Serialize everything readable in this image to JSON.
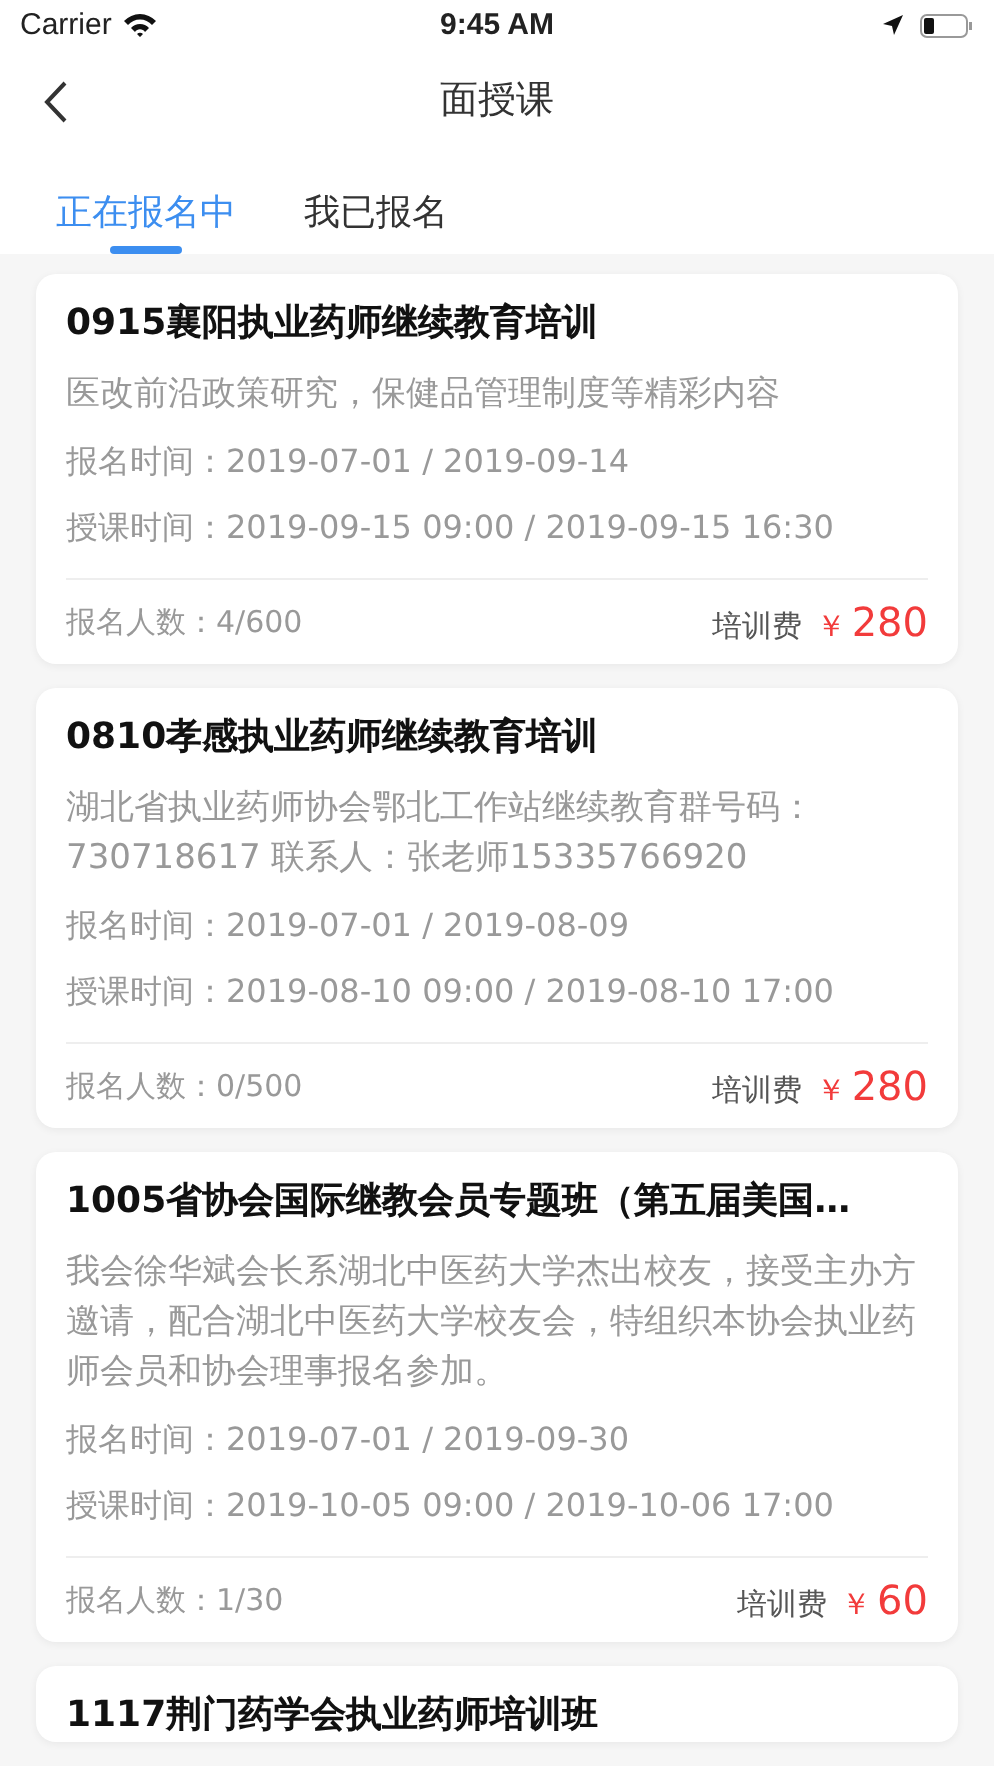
{
  "status_bar": {
    "carrier": "Carrier",
    "time": "9:45 AM"
  },
  "nav": {
    "title": "面授课"
  },
  "tabs": [
    {
      "label": "正在报名中",
      "selected": true
    },
    {
      "label": "我已报名",
      "selected": false
    }
  ],
  "courses": [
    {
      "title": "0915襄阳执业药师继续教育培训",
      "description": "医改前沿政策研究，保健品管理制度等精彩内容",
      "signup_time": "报名时间：2019-07-01 / 2019-09-14",
      "class_time": "授课时间：2019-09-15 09:00 / 2019-09-15 16:30",
      "enrollment": "报名人数：4/600",
      "fee_label": "培训费",
      "currency": "￥",
      "price": "280"
    },
    {
      "title": "0810孝感执业药师继续教育培训",
      "description": "湖北省执业药师协会鄂北工作站继续教育群号码：730718617  联系人：张老师15335766920",
      "signup_time": "报名时间：2019-07-01 / 2019-08-09",
      "class_time": "授课时间：2019-08-10 09:00 / 2019-08-10 17:00",
      "enrollment": "报名人数：0/500",
      "fee_label": "培训费",
      "currency": "￥",
      "price": "280"
    },
    {
      "title": "1005省协会国际继教会员专题班（第五届美国…",
      "description": "我会徐华斌会长系湖北中医药大学杰出校友，接受主办方邀请，配合湖北中医药大学校友会，特组织本协会执业药师会员和协会理事报名参加。",
      "signup_time": "报名时间：2019-07-01 / 2019-09-30",
      "class_time": "授课时间：2019-10-05 09:00 / 2019-10-06 17:00",
      "enrollment": "报名人数：1/30",
      "fee_label": "培训费",
      "currency": "￥",
      "price": "60"
    },
    {
      "title": "1117荆门药学会执业药师培训班"
    }
  ]
}
